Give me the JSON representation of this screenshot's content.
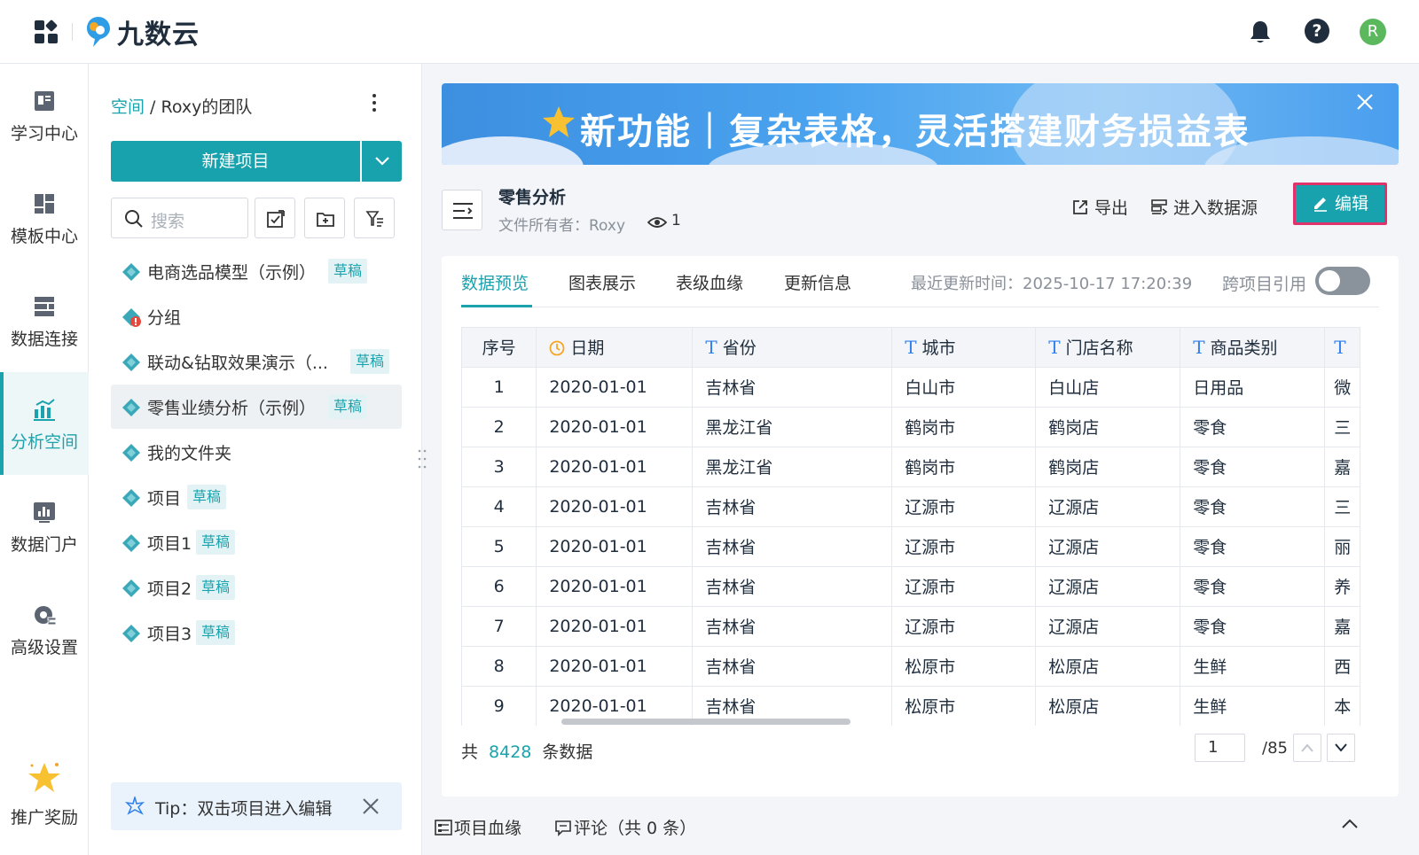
{
  "app": {
    "logo_text": "九数云"
  },
  "header": {
    "avatar_letter": "R",
    "help_glyph": "?"
  },
  "nav": {
    "items": [
      {
        "label": "学习中心",
        "icon": "book-icon"
      },
      {
        "label": "模板中心",
        "icon": "template-icon"
      },
      {
        "label": "数据连接",
        "icon": "data-connect-icon"
      },
      {
        "label": "分析空间",
        "icon": "analysis-icon",
        "active": true
      },
      {
        "label": "数据门户",
        "icon": "portal-icon"
      },
      {
        "label": "高级设置",
        "icon": "settings-icon"
      },
      {
        "label": "推广奖励",
        "icon": "star-icon"
      }
    ]
  },
  "panel": {
    "breadcrumb_space": "空间",
    "breadcrumb_sep": " / ",
    "breadcrumb_team": "Roxy的团队",
    "new_project": "新建项目",
    "search_placeholder": "搜索",
    "projects": [
      {
        "label": "电商选品模型（示例）",
        "badge": "草稿"
      },
      {
        "label": "分组",
        "badge": ""
      },
      {
        "label": "联动&钻取效果演示（...",
        "badge": "草稿"
      },
      {
        "label": "零售业绩分析（示例）",
        "badge": "草稿",
        "selected": true
      },
      {
        "label": "我的文件夹",
        "badge": ""
      },
      {
        "label": "项目",
        "badge": "草稿"
      },
      {
        "label": "项目1",
        "badge": "草稿"
      },
      {
        "label": "项目2",
        "badge": "草稿"
      },
      {
        "label": "项目3",
        "badge": "草稿"
      }
    ],
    "tip": "Tip：双击项目进入编辑"
  },
  "banner": {
    "text": "新功能｜复杂表格，灵活搭建财务损益表"
  },
  "report": {
    "title": "零售分析",
    "owner": "文件所有者：Roxy",
    "views": "1",
    "export_label": "导出",
    "datasource_label": "进入数据源",
    "edit_label": "编辑"
  },
  "tabs": {
    "items": [
      "数据预览",
      "图表展示",
      "表级血缘",
      "更新信息"
    ],
    "active_index": 0,
    "updated_label": "最近更新时间：2025-10-17 17:20:39",
    "cross_ref_label": "跨项目引用",
    "cross_ref_on": false
  },
  "table": {
    "headers": [
      "序号",
      "日期",
      "省份",
      "城市",
      "门店名称",
      "商品类别",
      ""
    ],
    "rows": [
      [
        "1",
        "2020-01-01",
        "吉林省",
        "白山市",
        "白山店",
        "日用品",
        "微"
      ],
      [
        "2",
        "2020-01-01",
        "黑龙江省",
        "鹤岗市",
        "鹤岗店",
        "零食",
        "三"
      ],
      [
        "3",
        "2020-01-01",
        "黑龙江省",
        "鹤岗市",
        "鹤岗店",
        "零食",
        "嘉"
      ],
      [
        "4",
        "2020-01-01",
        "吉林省",
        "辽源市",
        "辽源店",
        "零食",
        "三"
      ],
      [
        "5",
        "2020-01-01",
        "吉林省",
        "辽源市",
        "辽源店",
        "零食",
        "丽"
      ],
      [
        "6",
        "2020-01-01",
        "吉林省",
        "辽源市",
        "辽源店",
        "零食",
        "养"
      ],
      [
        "7",
        "2020-01-01",
        "吉林省",
        "辽源市",
        "辽源店",
        "零食",
        "嘉"
      ],
      [
        "8",
        "2020-01-01",
        "吉林省",
        "松原市",
        "松原店",
        "生鲜",
        "西"
      ],
      [
        "9",
        "2020-01-01",
        "吉林省",
        "松原市",
        "松原店",
        "生鲜",
        "本"
      ]
    ]
  },
  "footer": {
    "prefix": "共",
    "count": "8428",
    "suffix": "条数据",
    "page": "1",
    "total_pages": "/85"
  },
  "bottom": {
    "lineage": "项目血缘",
    "comments": "评论（共 0 条）"
  },
  "colors": {
    "accent": "#17a2ad",
    "edit_highlight": "#e0336b"
  }
}
